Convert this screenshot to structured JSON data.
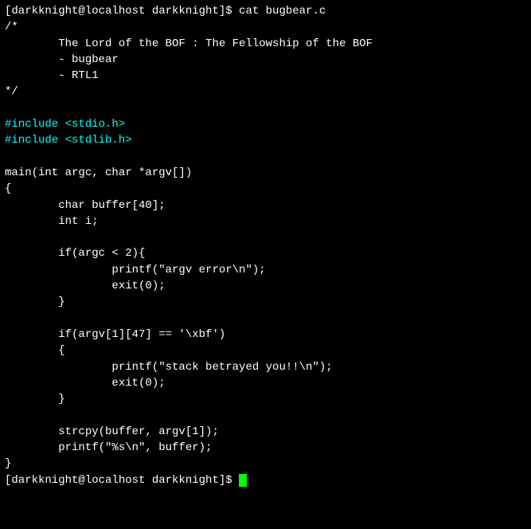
{
  "terminal": {
    "prompt1": "[darkknight@localhost darkknight]$ cat bugbear.c",
    "prompt2": "[darkknight@localhost darkknight]$ ",
    "lines": [
      {
        "id": "prompt-top",
        "text": "[darkknight@localhost darkknight]$ cat bugbear.c",
        "type": "prompt"
      },
      {
        "id": "comment-open",
        "text": "/*",
        "type": "comment"
      },
      {
        "id": "comment-title",
        "text": "        The Lord of the BOF : The Fellowship of the BOF",
        "type": "comment"
      },
      {
        "id": "comment-bugbear",
        "text": "        - bugbear",
        "type": "comment"
      },
      {
        "id": "comment-rtl1",
        "text": "        - RTL1",
        "type": "comment"
      },
      {
        "id": "comment-close",
        "text": "*/",
        "type": "comment"
      },
      {
        "id": "blank1",
        "text": "",
        "type": "blank"
      },
      {
        "id": "include1",
        "text": "#include <stdio.h>",
        "type": "preprocessor"
      },
      {
        "id": "include2",
        "text": "#include <stdlib.h>",
        "type": "preprocessor"
      },
      {
        "id": "blank2",
        "text": "",
        "type": "blank"
      },
      {
        "id": "main-sig",
        "text": "main(int argc, char *argv[])",
        "type": "code"
      },
      {
        "id": "brace-open",
        "text": "{",
        "type": "code"
      },
      {
        "id": "char-buf",
        "text": "        char buffer[40];",
        "type": "code"
      },
      {
        "id": "int-i",
        "text": "        int i;",
        "type": "code"
      },
      {
        "id": "blank3",
        "text": "",
        "type": "blank"
      },
      {
        "id": "if-argc",
        "text": "        if(argc < 2){",
        "type": "code"
      },
      {
        "id": "printf-argv",
        "text": "                printf(\"argv error\\n\");",
        "type": "code"
      },
      {
        "id": "exit0-1",
        "text": "                exit(0);",
        "type": "code"
      },
      {
        "id": "brace-mid1",
        "text": "        }",
        "type": "code"
      },
      {
        "id": "blank4",
        "text": "",
        "type": "blank"
      },
      {
        "id": "if-argv47",
        "text": "        if(argv[1][47] == '\\xbf')",
        "type": "code"
      },
      {
        "id": "brace-mid2",
        "text": "        {",
        "type": "code"
      },
      {
        "id": "printf-stack",
        "text": "                printf(\"stack betrayed you!!\\n\");",
        "type": "code"
      },
      {
        "id": "exit0-2",
        "text": "                exit(0);",
        "type": "code"
      },
      {
        "id": "brace-mid3",
        "text": "        }",
        "type": "code"
      },
      {
        "id": "blank5",
        "text": "",
        "type": "blank"
      },
      {
        "id": "strcpy",
        "text": "        strcpy(buffer, argv[1]);",
        "type": "code"
      },
      {
        "id": "printf-s",
        "text": "        printf(\"%s\\n\", buffer);",
        "type": "code"
      },
      {
        "id": "brace-close",
        "text": "}",
        "type": "code"
      },
      {
        "id": "prompt-bottom",
        "text": "[darkknight@localhost darkknight]$ ",
        "type": "prompt"
      }
    ]
  }
}
